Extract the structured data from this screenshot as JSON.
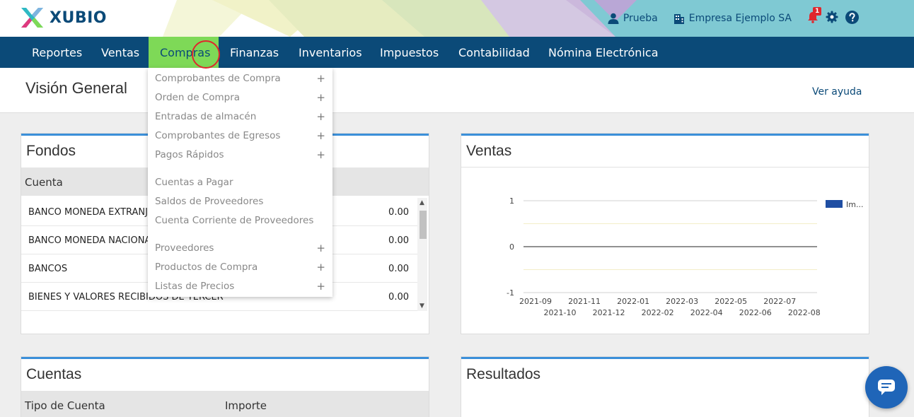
{
  "brand": {
    "name": "XUBIO"
  },
  "header": {
    "user": "Prueba",
    "company": "Empresa Ejemplo SA",
    "notification_count": "1",
    "icons": [
      "user-icon",
      "building-icon",
      "bell-icon",
      "gear-icon",
      "help-icon"
    ]
  },
  "nav": {
    "items": [
      "Reportes",
      "Ventas",
      "Compras",
      "Finanzas",
      "Inventarios",
      "Impuestos",
      "Contabilidad",
      "Nómina Electrónica"
    ],
    "active": "Compras"
  },
  "page": {
    "title": "Visión General",
    "help_link": "Ver ayuda"
  },
  "dropdown": {
    "items": [
      {
        "label": "Comprobantes de Compra",
        "plus": "+"
      },
      {
        "label": "Orden de Compra",
        "plus": "+"
      },
      {
        "label": "Entradas de almacén",
        "plus": "+"
      },
      {
        "label": "Comprobantes de Egresos",
        "plus": "+"
      },
      {
        "label": "Pagos Rápidos",
        "plus": "+"
      },
      {
        "label": "Cuentas a Pagar",
        "plus": ""
      },
      {
        "label": "Saldos de Proveedores",
        "plus": ""
      },
      {
        "label": "Cuenta Corriente de Proveedores",
        "plus": ""
      },
      {
        "label": "Proveedores",
        "plus": "+"
      },
      {
        "label": "Productos de Compra",
        "plus": "+"
      },
      {
        "label": "Listas de Precios",
        "plus": "+"
      }
    ]
  },
  "fondos": {
    "title": "Fondos",
    "column": "Cuenta",
    "rows": [
      {
        "cuenta": "BANCO MONEDA EXTRANJERA",
        "valor": "0.00"
      },
      {
        "cuenta": "BANCO MONEDA NACIONAL",
        "valor": "0.00"
      },
      {
        "cuenta": "BANCOS",
        "valor": "0.00"
      },
      {
        "cuenta": "BIENES Y VALORES RECIBIDOS DE TERCER",
        "valor": "0.00"
      }
    ]
  },
  "ventas": {
    "title": "Ventas",
    "chart_data": {
      "type": "bar",
      "categories": [
        "2021-09",
        "2021-10",
        "2021-11",
        "2021-12",
        "2022-01",
        "2022-02",
        "2022-03",
        "2022-04",
        "2022-05",
        "2022-06",
        "2022-07",
        "2022-08"
      ],
      "series": [
        {
          "name": "Im...",
          "values": [
            0,
            0,
            0,
            0,
            0,
            0,
            0,
            0,
            0,
            0,
            0,
            0
          ]
        }
      ],
      "ylim": [
        -1,
        1
      ],
      "yticks": [
        "1",
        "0",
        "-1"
      ],
      "legend": "top-right",
      "colors": {
        "series": "#1f4ea3"
      }
    }
  },
  "cuentas": {
    "title": "Cuentas",
    "columns": [
      "Tipo de Cuenta",
      "Importe"
    ]
  },
  "resultados": {
    "title": "Resultados"
  },
  "colors": {
    "nav": "#0b4a78",
    "active_tab": "#7ed957",
    "accent": "#3b8fd9",
    "chat": "#1f65b8"
  }
}
